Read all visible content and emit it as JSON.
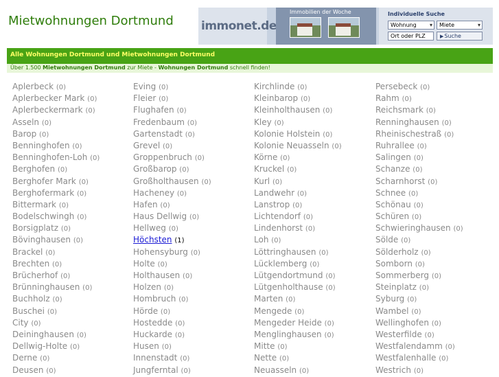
{
  "header": {
    "title": "Mietwohnungen Dortmund"
  },
  "banner": {
    "logo": "immonet.de",
    "week_label": "Immobilien der Woche",
    "search_title": "Individuelle Suche",
    "type_select": "Wohnung",
    "mode_select": "Miete",
    "place_input": "Ort oder PLZ",
    "search_button": "Suche"
  },
  "section": {
    "title": "Alle Wohnungen Dortmund und Mietwohnungen Dortmund",
    "subtitle_part1": "Über 1.500 ",
    "subtitle_bold1": "Mietwohnungen Dortmund",
    "subtitle_part2": " zur Miete - ",
    "subtitle_bold2": "Wohnungen Dortmund",
    "subtitle_part3": " schnell finden!"
  },
  "districts": [
    [
      {
        "name": "Aplerbeck",
        "count": "0"
      },
      {
        "name": "Aplerbecker Mark",
        "count": "0"
      },
      {
        "name": "Aplerbeckermark",
        "count": "0"
      },
      {
        "name": "Asseln",
        "count": "0"
      },
      {
        "name": "Barop",
        "count": "0"
      },
      {
        "name": "Benninghofen",
        "count": "0"
      },
      {
        "name": "Benninghofen-Loh",
        "count": "0"
      },
      {
        "name": "Berghofen",
        "count": "0"
      },
      {
        "name": "Berghofer Mark",
        "count": "0"
      },
      {
        "name": "Berghofermark",
        "count": "0"
      },
      {
        "name": "Bittermark",
        "count": "0"
      },
      {
        "name": "Bodelschwingh",
        "count": "0"
      },
      {
        "name": "Borsigplatz",
        "count": "0"
      },
      {
        "name": "Bövinghausen",
        "count": "0"
      },
      {
        "name": "Brackel",
        "count": "0"
      },
      {
        "name": "Brechten",
        "count": "0"
      },
      {
        "name": "Brücherhof",
        "count": "0"
      },
      {
        "name": "Brünninghausen",
        "count": "0"
      },
      {
        "name": "Buchholz",
        "count": "0"
      },
      {
        "name": "Buschei",
        "count": "0"
      },
      {
        "name": "City",
        "count": "0"
      },
      {
        "name": "Deininghausen",
        "count": "0"
      },
      {
        "name": "Dellwig-Holte",
        "count": "0"
      },
      {
        "name": "Derne",
        "count": "0"
      },
      {
        "name": "Deusen",
        "count": "0"
      }
    ],
    [
      {
        "name": "Eving",
        "count": "0"
      },
      {
        "name": "Fleier",
        "count": "0"
      },
      {
        "name": "Flughafen",
        "count": "0"
      },
      {
        "name": "Fredenbaum",
        "count": "0"
      },
      {
        "name": "Gartenstadt",
        "count": "0"
      },
      {
        "name": "Grevel",
        "count": "0"
      },
      {
        "name": "Groppenbruch",
        "count": "0"
      },
      {
        "name": "Großbarop",
        "count": "0"
      },
      {
        "name": "Großholthausen",
        "count": "0"
      },
      {
        "name": "Hacheney",
        "count": "0"
      },
      {
        "name": "Hafen",
        "count": "0"
      },
      {
        "name": "Haus Dellwig",
        "count": "0"
      },
      {
        "name": "Hellweg",
        "count": "0"
      },
      {
        "name": "Höchsten",
        "count": "1",
        "active": true
      },
      {
        "name": "Hohensyburg",
        "count": "0"
      },
      {
        "name": "Holte",
        "count": "0"
      },
      {
        "name": "Holthausen",
        "count": "0"
      },
      {
        "name": "Holzen",
        "count": "0"
      },
      {
        "name": "Hombruch",
        "count": "0"
      },
      {
        "name": "Hörde",
        "count": "0"
      },
      {
        "name": "Hostedde",
        "count": "0"
      },
      {
        "name": "Huckarde",
        "count": "0"
      },
      {
        "name": "Husen",
        "count": "0"
      },
      {
        "name": "Innenstadt",
        "count": "0"
      },
      {
        "name": "Jungferntal",
        "count": "0"
      }
    ],
    [
      {
        "name": "Kirchlinde",
        "count": "0"
      },
      {
        "name": "Kleinbarop",
        "count": "0"
      },
      {
        "name": "Kleinholthausen",
        "count": "0"
      },
      {
        "name": "Kley",
        "count": "0"
      },
      {
        "name": "Kolonie Holstein",
        "count": "0"
      },
      {
        "name": "Kolonie Neuasseln",
        "count": "0"
      },
      {
        "name": "Körne",
        "count": "0"
      },
      {
        "name": "Kruckel",
        "count": "0"
      },
      {
        "name": "Kurl",
        "count": "0"
      },
      {
        "name": "Landwehr",
        "count": "0"
      },
      {
        "name": "Lanstrop",
        "count": "0"
      },
      {
        "name": "Lichtendorf",
        "count": "0"
      },
      {
        "name": "Lindenhorst",
        "count": "0"
      },
      {
        "name": "Loh",
        "count": "0"
      },
      {
        "name": "Löttringhausen",
        "count": "0"
      },
      {
        "name": "Lücklemberg",
        "count": "0"
      },
      {
        "name": "Lütgendortmund",
        "count": "0"
      },
      {
        "name": "Lütgenholthause",
        "count": "0"
      },
      {
        "name": "Marten",
        "count": "0"
      },
      {
        "name": "Mengede",
        "count": "0"
      },
      {
        "name": "Mengeder Heide",
        "count": "0"
      },
      {
        "name": "Menglinghausen",
        "count": "0"
      },
      {
        "name": "Mitte",
        "count": "0"
      },
      {
        "name": "Nette",
        "count": "0"
      },
      {
        "name": "Neuasseln",
        "count": "0"
      }
    ],
    [
      {
        "name": "Persebeck",
        "count": "0"
      },
      {
        "name": "Rahm",
        "count": "0"
      },
      {
        "name": "Reichsmark",
        "count": "0"
      },
      {
        "name": "Renninghausen",
        "count": "0"
      },
      {
        "name": "Rheinischestraß",
        "count": "0"
      },
      {
        "name": "Ruhrallee",
        "count": "0"
      },
      {
        "name": "Salingen",
        "count": "0"
      },
      {
        "name": "Schanze",
        "count": "0"
      },
      {
        "name": "Scharnhorst",
        "count": "0"
      },
      {
        "name": "Schnee",
        "count": "0"
      },
      {
        "name": "Schönau",
        "count": "0"
      },
      {
        "name": "Schüren",
        "count": "0"
      },
      {
        "name": "Schwieringhausen",
        "count": "0"
      },
      {
        "name": "Sölde",
        "count": "0"
      },
      {
        "name": "Sölderholz",
        "count": "0"
      },
      {
        "name": "Somborn",
        "count": "0"
      },
      {
        "name": "Sommerberg",
        "count": "0"
      },
      {
        "name": "Steinplatz",
        "count": "0"
      },
      {
        "name": "Syburg",
        "count": "0"
      },
      {
        "name": "Wambel",
        "count": "0"
      },
      {
        "name": "Wellinghofen",
        "count": "0"
      },
      {
        "name": "Westerfilde",
        "count": "0"
      },
      {
        "name": "Westfalendamm",
        "count": "0"
      },
      {
        "name": "Westfalenhalle",
        "count": "0"
      },
      {
        "name": "Westrich",
        "count": "0"
      }
    ]
  ]
}
